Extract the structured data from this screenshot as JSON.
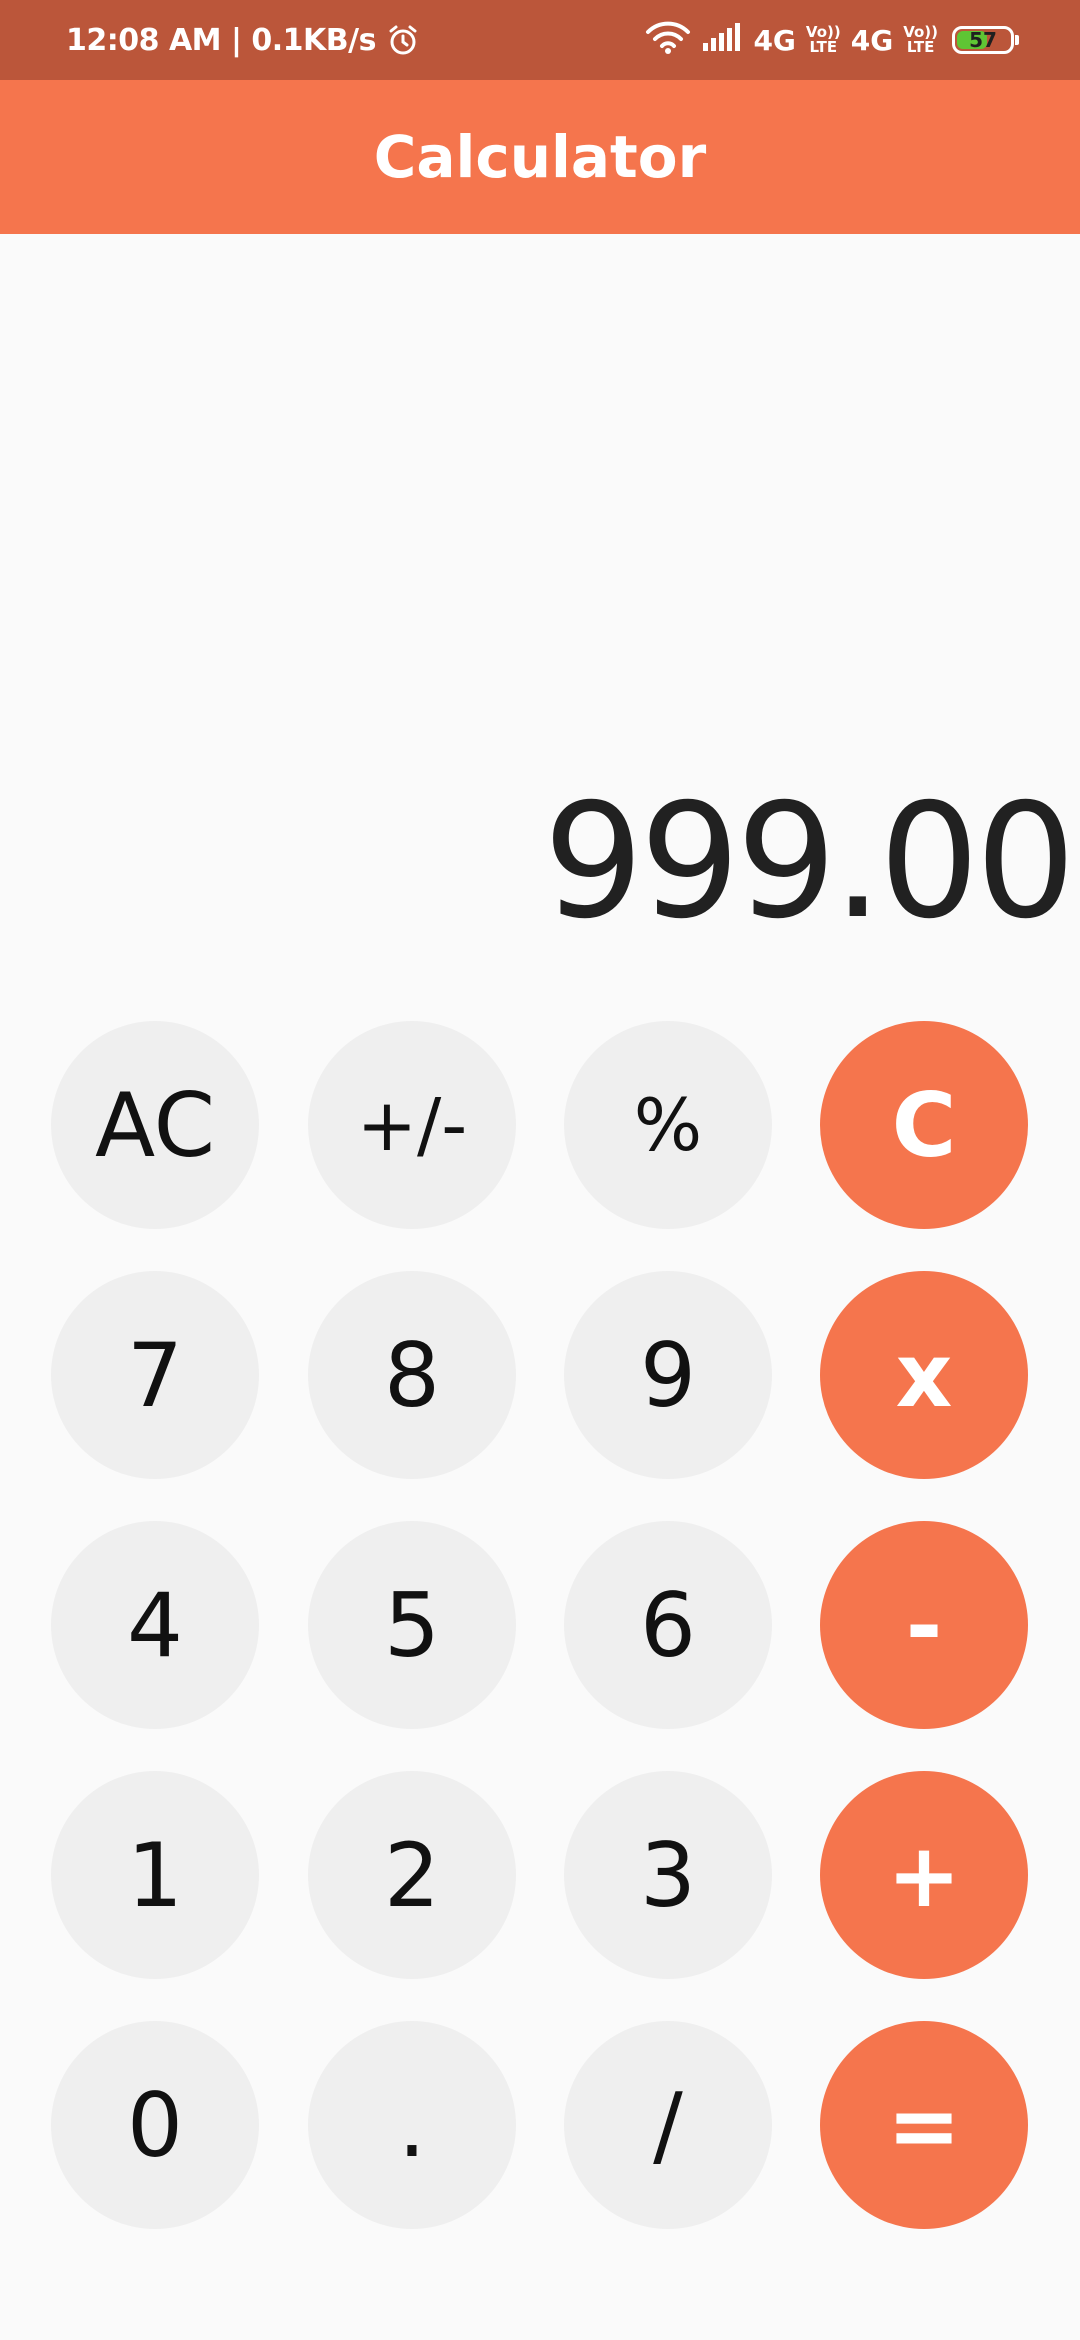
{
  "status_bar": {
    "time_speed": "12:08 AM | 0.1KB/s",
    "network_left": "4G",
    "lte_top": "Vo))",
    "lte_bottom": "LTE",
    "network_right": "4G",
    "battery_level": 57,
    "battery_label": "57"
  },
  "app_bar": {
    "title": "Calculator"
  },
  "display": {
    "value": "999.00"
  },
  "keys": {
    "ac": "AC",
    "plus_minus": "+/-",
    "percent": "%",
    "clear": "C",
    "seven": "7",
    "eight": "8",
    "nine": "9",
    "multiply": "x",
    "four": "4",
    "five": "5",
    "six": "6",
    "minus": "-",
    "one": "1",
    "two": "2",
    "three": "3",
    "plus": "+",
    "zero": "0",
    "dot": ".",
    "divide": "/",
    "equals": "="
  },
  "colors": {
    "accent": "#f5754d",
    "status_bar": "#bb563a",
    "key_background": "#efefef",
    "page_background": "#fafafa"
  }
}
